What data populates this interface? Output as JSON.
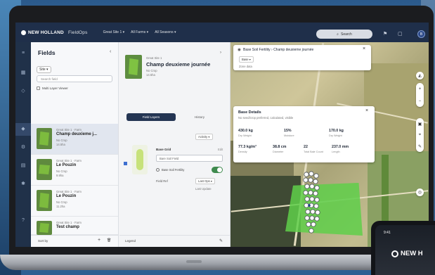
{
  "app": {
    "brand": "NEW HOLLAND",
    "product": "FieldOps",
    "breadcrumbs": [
      "Great Site 1 ▾",
      "All Farms ▾",
      "All Seasons ▾"
    ],
    "search_label": "Search",
    "avatar_initials": "B"
  },
  "fields_panel": {
    "title": "Fields",
    "farm_filter": "Site ▾",
    "search_placeholder": "Search field",
    "multi_select_label": "Multi Layer Viewer",
    "items": [
      {
        "farm": "Great Site 1 · Farm",
        "name": "Champ deuxieme j...",
        "meta1": "No Crop",
        "meta2": "14.5ha",
        "active": true
      },
      {
        "farm": "Great Site 1 · Farm",
        "name": "Le Pouzin",
        "meta1": "No Crop",
        "meta2": "9.9ha",
        "active": false
      },
      {
        "farm": "Great Site 1 · Farm",
        "name": "Le Pouzin",
        "meta1": "No Crop",
        "meta2": "11.2ha",
        "active": false
      },
      {
        "farm": "Great Site 1 · Farm",
        "name": "Test champ",
        "meta1": "No Crop",
        "meta2": "7.8ha",
        "active": false
      }
    ],
    "footer_left": "Sort by",
    "footer_add": "+",
    "footer_delete": "🗑"
  },
  "detail_panel": {
    "farm": "Great Site 1",
    "name": "Champ deuxieme journée",
    "meta1": "No Crop",
    "meta2": "14.5ha",
    "primary_button": "Field Layers",
    "secondary_link": "History",
    "activity_select": "Activity ▾",
    "section_label": "Base Grid",
    "section_right": "Edit",
    "dropdown_value": "Bare Soil Field",
    "toggle_label": "Base Soil Fertility",
    "field_a": "Field Ref",
    "field_b": "Last Ops ▾",
    "field_c": "Last Update",
    "footer_left": "Legend"
  },
  "map_header_card": {
    "title": "Base Soil Fertility › Champ deuxieme journée",
    "select": "Base ▾",
    "sub": "Zone data"
  },
  "base_details_card": {
    "title": "Base Details",
    "sub": "No seed/crop preferred, calculated, visible",
    "stats": [
      {
        "value": "430.0 kg",
        "label": "Dry Weight"
      },
      {
        "value": "15%",
        "label": "Moisture"
      },
      {
        "value": "170.0 kg",
        "label": "Dry Weight"
      },
      {
        "value": "77.3 kg/m³",
        "label": "Density"
      },
      {
        "value": "38.8 cm",
        "label": "Diameter"
      },
      {
        "value": "22",
        "label": "Total Bale Count"
      },
      {
        "value": "237.0 mm",
        "label": "Length"
      }
    ]
  },
  "phone": {
    "time": "9:41",
    "brand": "NEW H"
  }
}
